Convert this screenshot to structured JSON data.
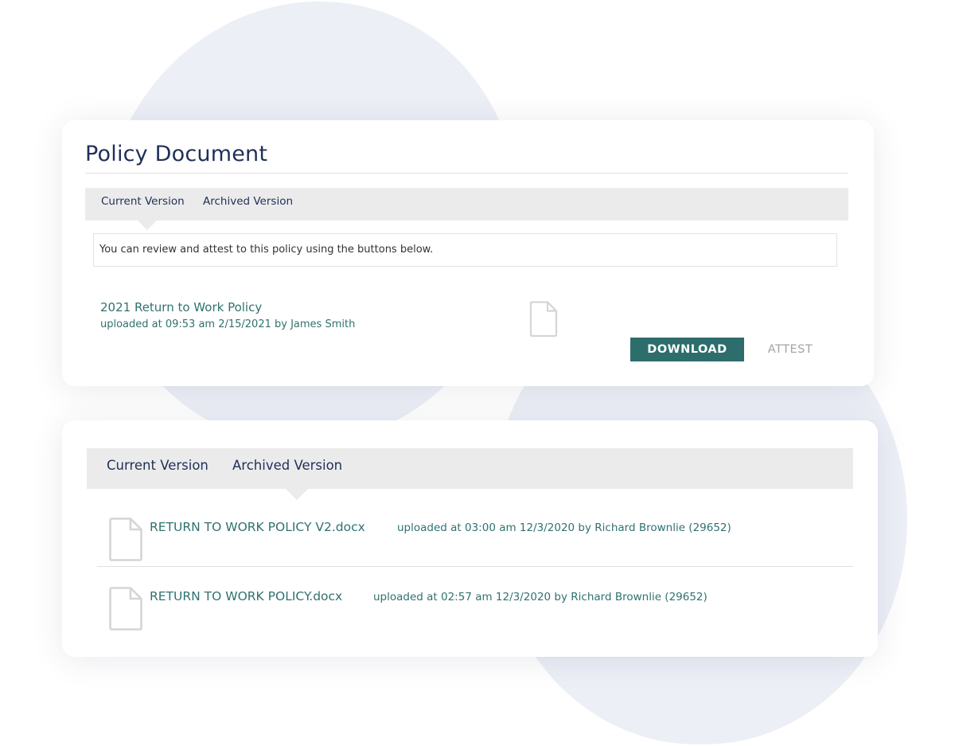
{
  "policy_card": {
    "title": "Policy Document",
    "tabs": [
      {
        "label": "Current Version",
        "active": true
      },
      {
        "label": "Archived Version",
        "active": false
      }
    ],
    "notice": "You can review and attest to this policy using the buttons below.",
    "document": {
      "name": "2021 Return to Work Policy",
      "meta": "uploaded at 09:53 am 2/15/2021 by James Smith",
      "icon": "file-icon"
    },
    "download_label": "DOWNLOAD",
    "attest_label": "ATTEST"
  },
  "archive_card": {
    "tabs": [
      {
        "label": "Current Version",
        "active": false
      },
      {
        "label": "Archived Version",
        "active": true
      }
    ],
    "files": [
      {
        "name": "RETURN TO WORK POLICY V2.docx",
        "meta": "uploaded at 03:00 am 12/3/2020 by Richard Brownlie (29652)",
        "icon": "file-icon"
      },
      {
        "name": "RETURN TO WORK POLICY.docx",
        "meta": "uploaded at 02:57 am 12/3/2020 by Richard Brownlie (29652)",
        "icon": "file-icon"
      }
    ]
  },
  "colors": {
    "accent": "#2d6d6c",
    "link": "#2f7270",
    "title": "#1f2f57",
    "tab_bar": "#ebebeb",
    "background_blob": "#eceff6"
  }
}
